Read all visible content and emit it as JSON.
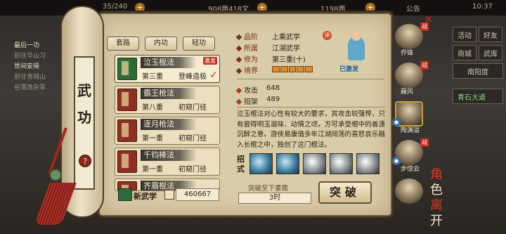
{
  "topbar": {
    "resource1": "35/240",
    "resource2": "908两418文",
    "resource3": "1198两",
    "notice": "公告",
    "time": "10:37"
  },
  "left_log": {
    "line1": "最后一功",
    "line2": "前往华山习",
    "line3": "世间安得",
    "line4": "前往青城山",
    "line5": "谷落逸杂草"
  },
  "right_menu": [
    "活动",
    "商城",
    "南阳度",
    "青石大道"
  ],
  "right_menu_extra": [
    "好友",
    "武库"
  ],
  "scroll": {
    "title": "武功",
    "help": "?"
  },
  "tabs": [
    "套路",
    "内功",
    "轻功"
  ],
  "skills": [
    {
      "name": "泣玉棍法",
      "rank": "第三重",
      "level": "登峰造极",
      "badge": "激发",
      "selected": true
    },
    {
      "name": "霸王枪法",
      "rank": "第八重",
      "level": "初窥门径"
    },
    {
      "name": "逐月枪法",
      "rank": "第一重",
      "level": "初窥门径"
    },
    {
      "name": "千钧棒法",
      "rank": "第一重",
      "level": "初窥门径"
    },
    {
      "name": "齐眉棍法",
      "rank": "",
      "level": ""
    }
  ],
  "footer": {
    "new_label": "新武学",
    "count": "460667"
  },
  "detail": {
    "grade_label": "品阶",
    "grade_value": "上乘武学",
    "grade_badge": "评",
    "sect_label": "所属",
    "sect_value": "江湖武学",
    "cultivation_label": "修为",
    "cultivation_value": "第三重(十)",
    "realm_label": "境界",
    "activated": "已激发",
    "attack_label": "攻击",
    "attack_value": "648",
    "parry_label": "招架",
    "parry_value": "489",
    "description": "泣玉棍法对心性有较大的要求，其攻击较强悍，只有尝得明玉滋味、动情之顷，方可承受棍中的善潇沉醉之意。游侠易康借多年江湖闯荡的喜怒哀乐融入长棍之中，独创了这门棍法。",
    "moves_label": "招式",
    "breakthrough_label": "突破至下重需",
    "time_value": "3时",
    "break_button": "突破"
  },
  "characters": [
    {
      "name": "乔锋",
      "flag": "战"
    },
    {
      "name": "聂风",
      "flag": "战"
    },
    {
      "name": "陶渊溢",
      "flag": "",
      "selected": true
    },
    {
      "name": "步惊云",
      "flag": "战"
    },
    {
      "name": "",
      "flag": ""
    }
  ],
  "calligraphy": {
    "char1": "角",
    "char2": "色",
    "char3": "离",
    "char4": "开"
  }
}
